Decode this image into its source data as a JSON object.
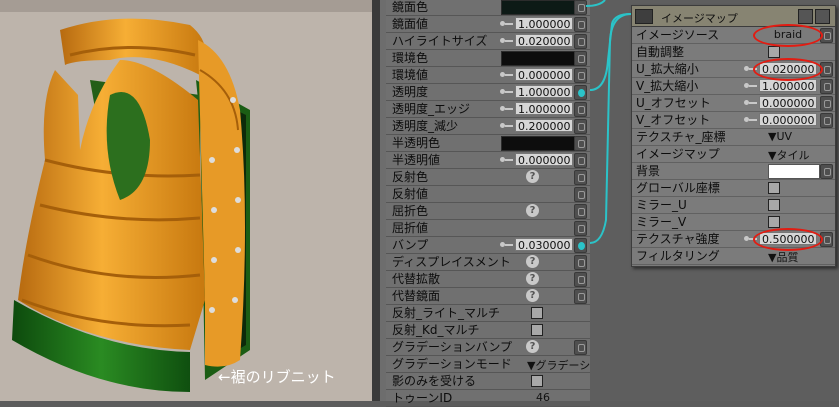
{
  "viewport": {
    "caption": "←裾のリブニット"
  },
  "material_panel": {
    "rows": [
      {
        "label": "鏡面色",
        "kind": "swatch",
        "color": "#0d1a16"
      },
      {
        "label": "鏡面値",
        "kind": "value",
        "value": "1.000000"
      },
      {
        "label": "ハイライトサイズ",
        "kind": "value",
        "value": "0.020000"
      },
      {
        "label": "環境色",
        "kind": "swatch",
        "color": "#0d0d0d"
      },
      {
        "label": "環境値",
        "kind": "value",
        "value": "0.000000"
      },
      {
        "label": "透明度",
        "kind": "value",
        "value": "1.000000",
        "connected": true
      },
      {
        "label": "透明度_エッジ",
        "kind": "value",
        "value": "1.000000"
      },
      {
        "label": "透明度_減少",
        "kind": "value",
        "value": "0.200000"
      },
      {
        "label": "半透明色",
        "kind": "swatch",
        "color": "#0d0d0d"
      },
      {
        "label": "半透明値",
        "kind": "value",
        "value": "0.000000"
      },
      {
        "label": "反射色",
        "kind": "help"
      },
      {
        "label": "反射値",
        "kind": "empty"
      },
      {
        "label": "屈折色",
        "kind": "help"
      },
      {
        "label": "屈折値",
        "kind": "empty"
      },
      {
        "label": "バンプ",
        "kind": "value",
        "value": "0.030000",
        "connected": true
      },
      {
        "label": "ディスプレイスメント",
        "kind": "help"
      },
      {
        "label": "代替拡散",
        "kind": "help"
      },
      {
        "label": "代替鏡面",
        "kind": "help"
      },
      {
        "label": "反射_ライト_マルチ",
        "kind": "checkbox"
      },
      {
        "label": "反射_Kd_マルチ",
        "kind": "checkbox"
      },
      {
        "label": "グラデーションバンプ",
        "kind": "help"
      },
      {
        "label": "グラデーションモード",
        "kind": "dropdown",
        "value": "▼グラデーションバンプ"
      },
      {
        "label": "影のみを受ける",
        "kind": "checkbox"
      },
      {
        "label": "トゥーンID",
        "kind": "number",
        "value": "46"
      }
    ]
  },
  "image_map_node": {
    "title": "イメージマップ",
    "rows": [
      {
        "label": "イメージソース",
        "kind": "source",
        "value": "braid",
        "highlight": true
      },
      {
        "label": "自動調整",
        "kind": "checkbox"
      },
      {
        "label": "U_拡大縮小",
        "kind": "value",
        "value": "0.020000",
        "highlight": true
      },
      {
        "label": "V_拡大縮小",
        "kind": "value",
        "value": "1.000000"
      },
      {
        "label": "U_オフセット",
        "kind": "value",
        "value": "0.000000"
      },
      {
        "label": "V_オフセット",
        "kind": "value",
        "value": "0.000000"
      },
      {
        "label": "テクスチャ_座標",
        "kind": "dropdown",
        "value": "▼UV"
      },
      {
        "label": "イメージマップ",
        "kind": "dropdown",
        "value": "▼タイル"
      },
      {
        "label": "背景",
        "kind": "white"
      },
      {
        "label": "グローバル座標",
        "kind": "checkbox"
      },
      {
        "label": "ミラー_U",
        "kind": "checkbox"
      },
      {
        "label": "ミラー_V",
        "kind": "checkbox"
      },
      {
        "label": "テクスチャ強度",
        "kind": "value",
        "value": "0.500000",
        "highlight": true
      },
      {
        "label": "フィルタリング",
        "kind": "dropdown",
        "value": "▼品質"
      }
    ]
  },
  "colors": {
    "wire": "#2bc3c8",
    "highlight_ring": "#e21c12",
    "vest_orange": "#f0a028",
    "rib_green": "#1d7a1d"
  }
}
